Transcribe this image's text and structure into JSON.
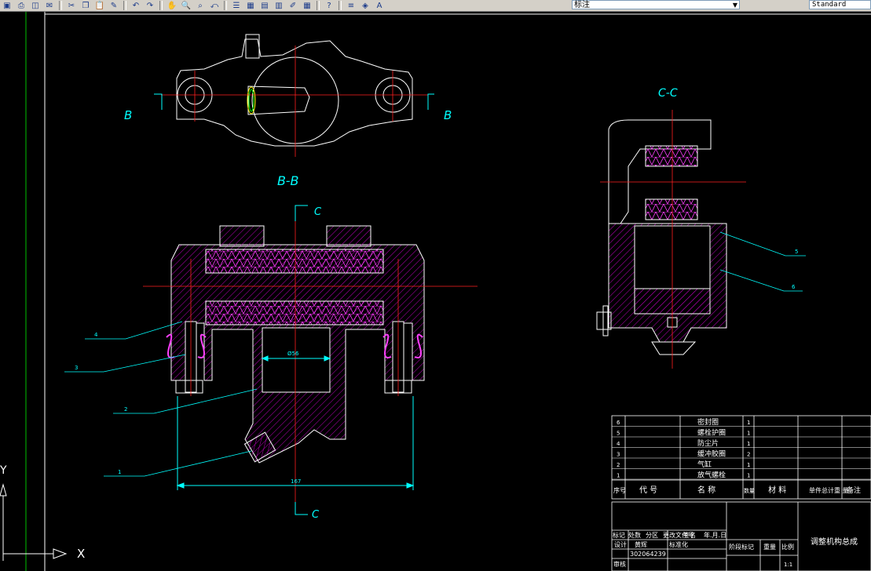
{
  "toolbar": {
    "layer_name": "标注",
    "dimstyle_name": "Standard",
    "icons": [
      "save-icon",
      "print-icon",
      "preview-icon",
      "publish-icon",
      "cut-icon",
      "copy-icon",
      "paste-icon",
      "match-prop-icon",
      "undo-icon",
      "redo-icon",
      "pan-icon",
      "zoom-realtime-icon",
      "zoom-window-icon",
      "zoom-previous-icon",
      "properties-icon",
      "design-center-icon",
      "tool-palette-icon",
      "sheet-set-icon",
      "markup-icon",
      "calc-icon",
      "help-icon",
      "layer-manager-icon",
      "layer-state-icon",
      "dimstyle-icon"
    ]
  },
  "drawing": {
    "section_label_bb": "B-B",
    "section_label_cc": "C-C",
    "label_b_left": "B",
    "label_b_right": "B",
    "label_c_top": "C",
    "label_c_bottom": "C",
    "dim_bore": "Ø56",
    "dim_width": "167",
    "callouts": [
      "1",
      "2",
      "3",
      "4",
      "5",
      "6"
    ],
    "ucs_x": "X",
    "ucs_y": "Y"
  },
  "parts_list": {
    "rows": [
      {
        "no": "6",
        "name": "密封圈",
        "qty": "1"
      },
      {
        "no": "5",
        "name": "螺栓护圈",
        "qty": "1"
      },
      {
        "no": "4",
        "name": "防尘片",
        "qty": "1"
      },
      {
        "no": "3",
        "name": "缓冲胶圈",
        "qty": "2"
      },
      {
        "no": "2",
        "name": "气缸",
        "qty": "1"
      },
      {
        "no": "1",
        "name": "放气螺栓",
        "qty": "1"
      }
    ],
    "header": {
      "no": "序号",
      "code": "代  号",
      "name": "名  称",
      "qty": "数量",
      "material": "材  料",
      "weight": "单件总计重 量",
      "remark": "备注"
    }
  },
  "title_block": {
    "drawing_title": "调整机构总成",
    "labels": [
      "标记",
      "处数",
      "分区",
      "更改文件号",
      "签名",
      "年.月.日",
      "设计",
      "标准化",
      "阶段标记",
      "重量",
      "比例",
      "审核"
    ],
    "designer": "黄辉",
    "student_id": "302064239",
    "scale": "1:1"
  }
}
